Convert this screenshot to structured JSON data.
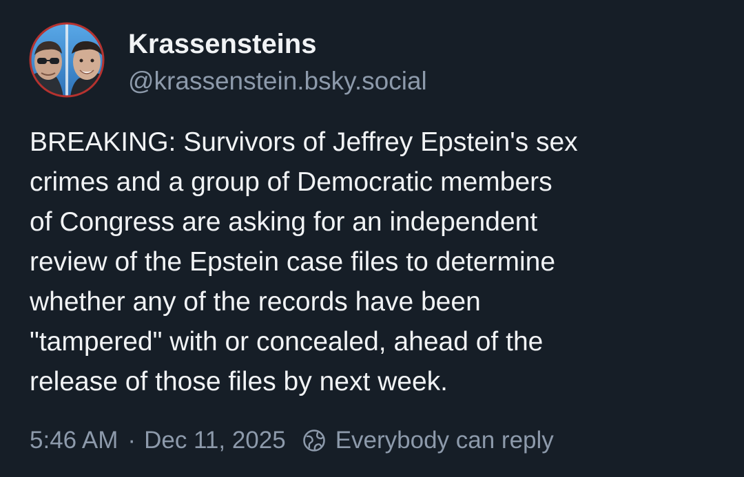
{
  "author": {
    "display_name": "Krassensteins",
    "handle": "@krassenstein.bsky.social",
    "avatar_icon": "twin-portrait-avatar"
  },
  "post": {
    "text_lines": [
      "BREAKING: Survivors of Jeffrey Epstein's sex",
      "crimes and a group of Democratic members",
      "of Congress are asking for an independent",
      "review of the Epstein case files to determine",
      "whether any of the records have been",
      "\"tampered\" with or concealed, ahead of the",
      "release of those files by next week."
    ],
    "time": "5:46 AM",
    "separator": "·",
    "date": "Dec 11, 2025",
    "reply_icon": "globe-icon",
    "reply_setting": "Everybody can reply"
  },
  "colors": {
    "background": "#161e27",
    "primary_text": "#f1f3f5",
    "secondary_text": "#8d9aab",
    "avatar_ring": "#b5322f",
    "avatar_sky": "#3f8fd6"
  }
}
